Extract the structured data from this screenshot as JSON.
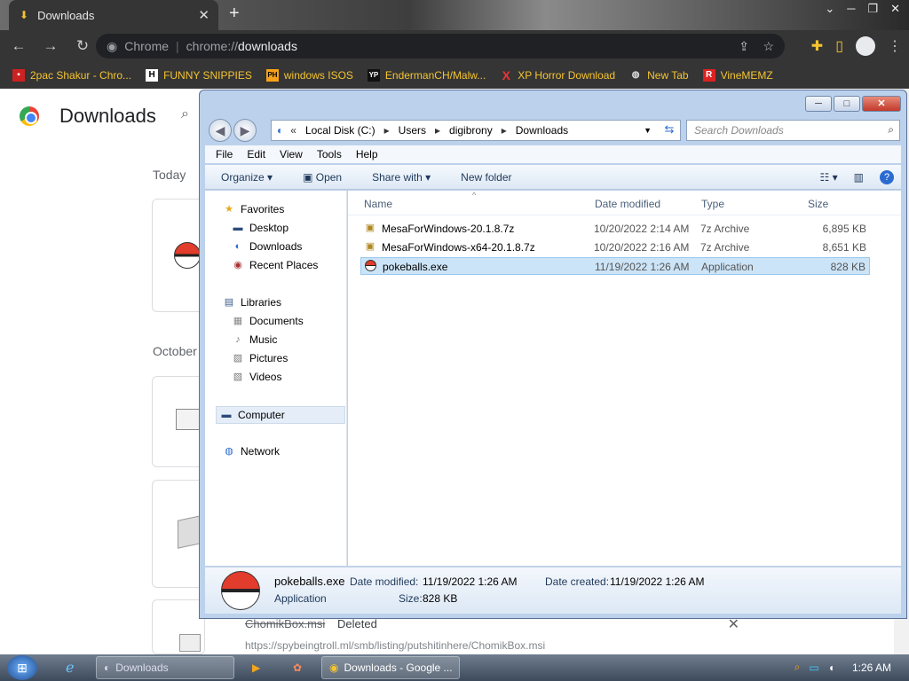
{
  "chrome": {
    "tab_title": "Downloads",
    "omnibox_scheme": "Chrome",
    "omnibox_url_prefix": "chrome://",
    "omnibox_url_host": "downloads",
    "bookmarks": [
      {
        "label": "2pac Shakur - Chro...",
        "icon": "red-square-icon"
      },
      {
        "label": "FUNNY SNIPPIES",
        "icon": "H"
      },
      {
        "label": "windows ISOS",
        "icon": "PH"
      },
      {
        "label": "EndermanCH/Malw...",
        "icon": "YP"
      },
      {
        "label": "XP Horror Download",
        "icon": "X"
      },
      {
        "label": "New Tab",
        "icon": "globe-icon"
      },
      {
        "label": "VineMEMZ",
        "icon": "R"
      }
    ],
    "page_title": "Downloads",
    "section_today": "Today",
    "section_october": "October",
    "deleted_file": "ChomikBox.msi",
    "deleted_status": "Deleted",
    "deleted_url": "https://spybeingtroll.ml/smb/listing/putshitinhere/ChomikBox.msi"
  },
  "explorer": {
    "breadcrumb": [
      "Local Disk (C:)",
      "Users",
      "digibrony",
      "Downloads"
    ],
    "search_placeholder": "Search Downloads",
    "menu": [
      "File",
      "Edit",
      "View",
      "Tools",
      "Help"
    ],
    "commands": {
      "organize": "Organize",
      "open": "Open",
      "share": "Share with",
      "new_folder": "New folder"
    },
    "nav": {
      "favorites": "Favorites",
      "desktop": "Desktop",
      "downloads": "Downloads",
      "recent": "Recent Places",
      "libraries": "Libraries",
      "documents": "Documents",
      "music": "Music",
      "pictures": "Pictures",
      "videos": "Videos",
      "computer": "Computer",
      "network": "Network"
    },
    "columns": {
      "name": "Name",
      "date": "Date modified",
      "type": "Type",
      "size": "Size"
    },
    "files": [
      {
        "name": "MesaForWindows-20.1.8.7z",
        "date": "10/20/2022 2:14 AM",
        "type": "7z Archive",
        "size": "6,895 KB"
      },
      {
        "name": "MesaForWindows-x64-20.1.8.7z",
        "date": "10/20/2022 2:16 AM",
        "type": "7z Archive",
        "size": "8,651 KB"
      },
      {
        "name": "pokeballs.exe",
        "date": "11/19/2022 1:26 AM",
        "type": "Application",
        "size": "828 KB"
      }
    ],
    "details": {
      "name": "pokeballs.exe",
      "type": "Application",
      "date_modified_label": "Date modified:",
      "date_modified": "11/19/2022 1:26 AM",
      "date_created_label": "Date created:",
      "date_created": "11/19/2022 1:26 AM",
      "size_label": "Size:",
      "size": "828 KB"
    }
  },
  "taskbar": {
    "explorer_label": "Downloads",
    "chrome_label": "Downloads - Google ...",
    "clock": "1:26 AM"
  },
  "colors": {
    "chrome_dark": "#353535",
    "bookmark_text": "#f4c430",
    "selection": "#cce4f7"
  }
}
